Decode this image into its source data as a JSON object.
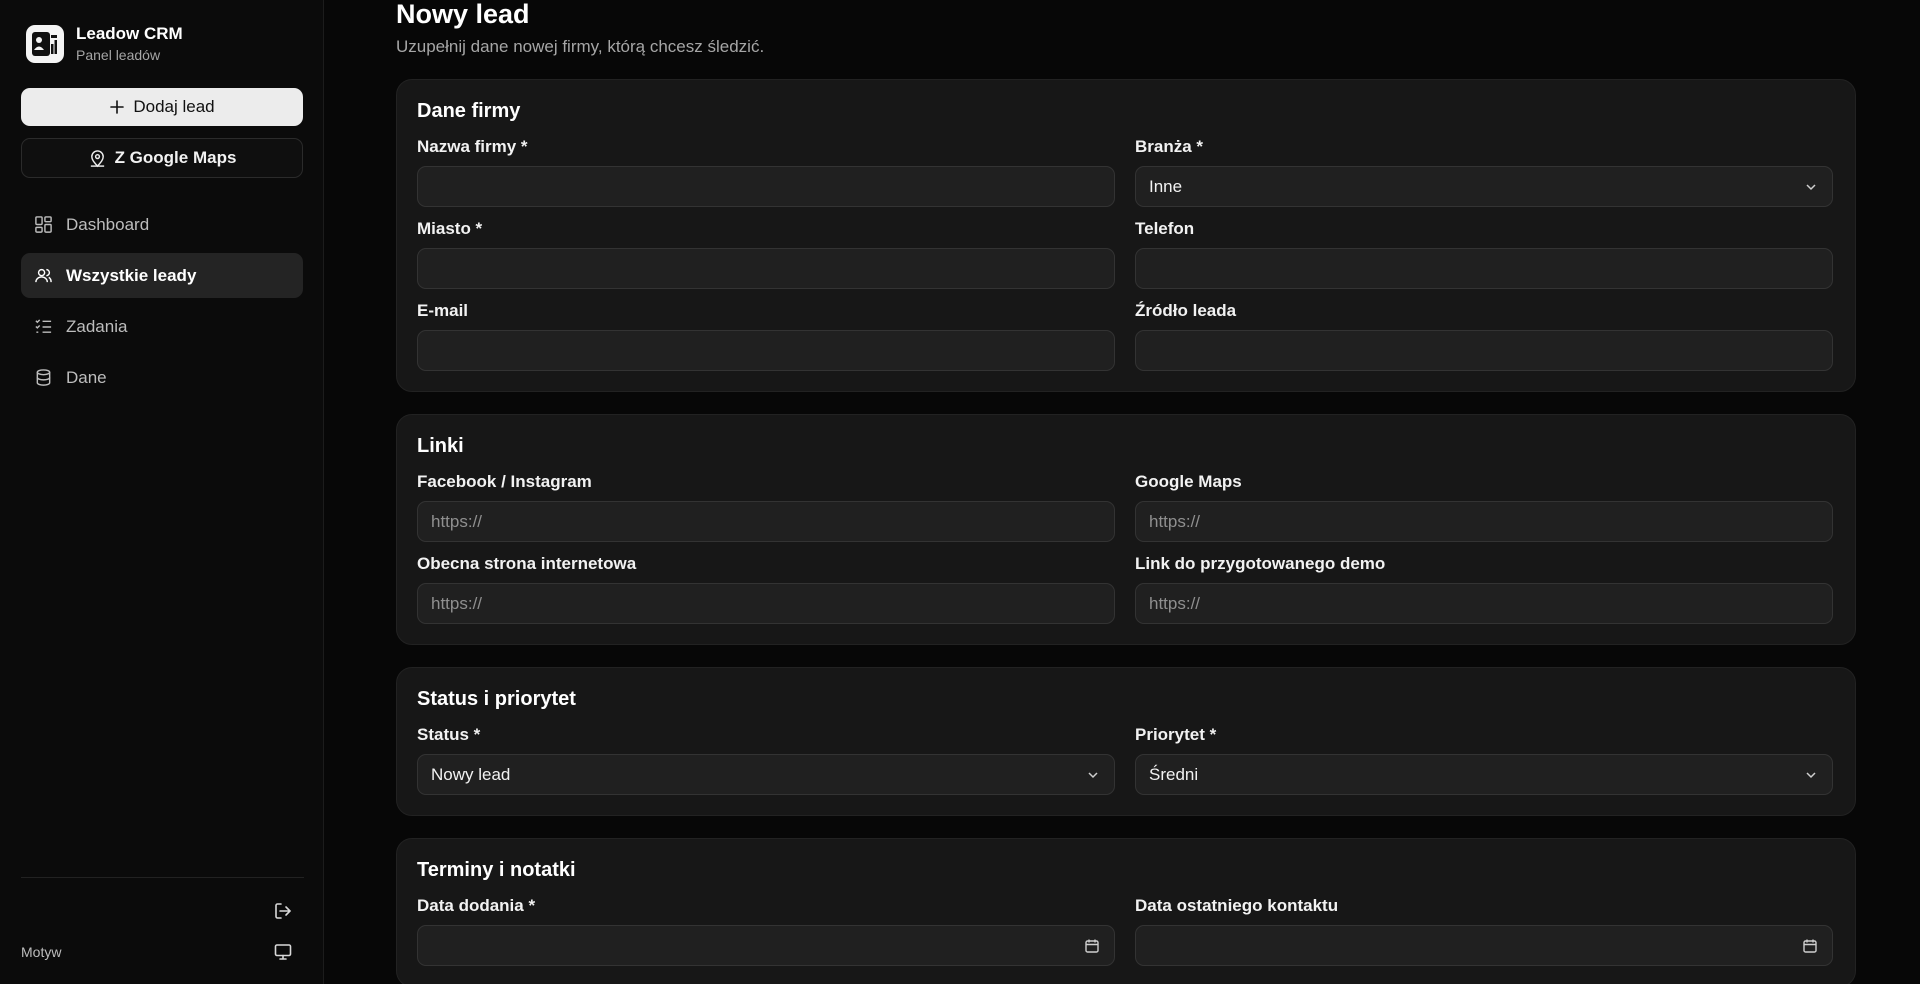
{
  "brand": {
    "title": "Leadow CRM",
    "subtitle": "Panel leadów"
  },
  "sidebar": {
    "add_lead": "Dodaj lead",
    "google_maps": "Z Google Maps",
    "items": [
      {
        "label": "Dashboard",
        "icon": "dashboard-icon",
        "active": false
      },
      {
        "label": "Wszystkie leady",
        "icon": "users-icon",
        "active": true
      },
      {
        "label": "Zadania",
        "icon": "tasks-icon",
        "active": false
      },
      {
        "label": "Dane",
        "icon": "database-icon",
        "active": false
      }
    ],
    "theme_label": "Motyw"
  },
  "page": {
    "title": "Nowy lead",
    "subtitle": "Uzupełnij dane nowej firmy, którą chcesz śledzić."
  },
  "sections": {
    "company": {
      "title": "Dane firmy",
      "name_label": "Nazwa firmy *",
      "industry_label": "Branża *",
      "industry_value": "Inne",
      "city_label": "Miasto *",
      "phone_label": "Telefon",
      "email_label": "E-mail",
      "source_label": "Źródło leada"
    },
    "links": {
      "title": "Linki",
      "facebook_label": "Facebook / Instagram",
      "google_maps_label": "Google Maps",
      "website_label": "Obecna strona internetowa",
      "demo_label": "Link do przygotowanego demo",
      "placeholder": "https://"
    },
    "status": {
      "title": "Status i priorytet",
      "status_label": "Status *",
      "status_value": "Nowy lead",
      "priority_label": "Priorytet *",
      "priority_value": "Średni"
    },
    "dates": {
      "title": "Terminy i notatki",
      "added_label": "Data dodania *",
      "last_contact_label": "Data ostatniego kontaktu"
    }
  },
  "colors": {
    "background": "#070707",
    "card": "#171717",
    "accent_button": "#ececec",
    "active_nav": "#242424"
  }
}
